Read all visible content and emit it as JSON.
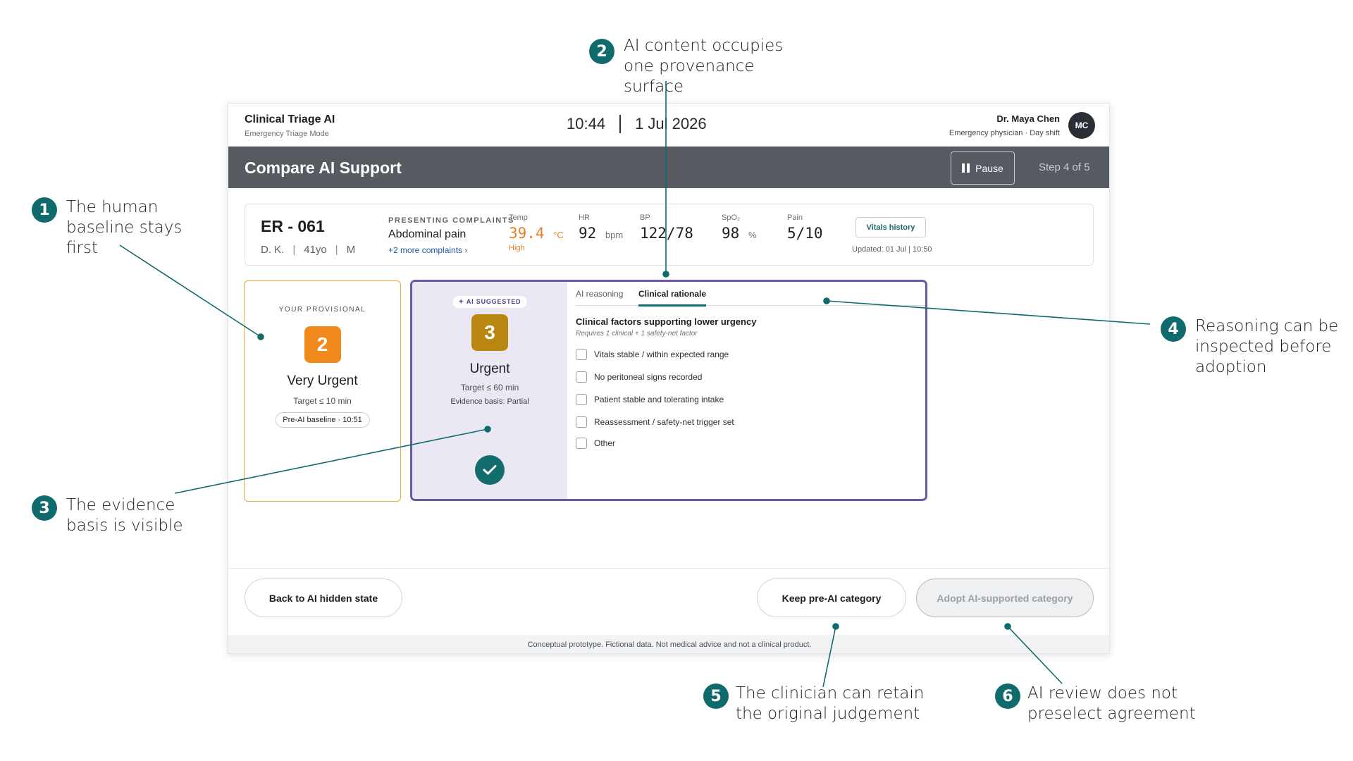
{
  "app": {
    "title": "Clinical Triage AI",
    "mode": "Emergency Triage Mode",
    "time": "10:44",
    "date": "1 Jul 2026",
    "user_name": "Dr. Maya Chen",
    "user_role": "Emergency physician · Day shift",
    "avatar_initials": "MC"
  },
  "titlebar": {
    "title": "Compare AI Support",
    "pause_label": "Pause",
    "step": "Step 4 of 5"
  },
  "patient": {
    "id": "ER - 061",
    "initials": "D. K.",
    "age": "41yo",
    "sex": "M",
    "complaints_label": "PRESENTING COMPLAINTS",
    "complaint": "Abdominal pain",
    "more_complaints": "+2 more complaints  ›",
    "vitals": [
      {
        "label": "Temp",
        "value": "39.4",
        "unit": "°C",
        "flag": "High"
      },
      {
        "label": "HR",
        "value": "92",
        "unit": "bpm",
        "flag": ""
      },
      {
        "label": "BP",
        "value": "122/78",
        "unit": "",
        "flag": ""
      },
      {
        "label": "SpO₂",
        "value": "98",
        "unit": "%",
        "flag": ""
      },
      {
        "label": "Pain",
        "value": "5/10",
        "unit": "",
        "flag": ""
      }
    ],
    "vitals_history_label": "Vitals history",
    "updated": "Updated: 01 Jul | 10:50"
  },
  "provisional": {
    "eyebrow": "YOUR PROVISIONAL",
    "tier": "2",
    "name": "Very Urgent",
    "target": "Target ≤ 10 min",
    "baseline": "Pre-AI baseline · 10:51",
    "color": "#f08a1c"
  },
  "ai": {
    "tag": "AI SUGGESTED",
    "tier": "3",
    "name": "Urgent",
    "target": "Target ≤ 60 min",
    "evidence": "Evidence basis: Partial",
    "color": "#b9860f",
    "tabs": [
      "AI reasoning",
      "Clinical rationale"
    ],
    "active_tab": "Clinical rationale",
    "rationale_title": "Clinical factors supporting lower urgency",
    "rationale_sub": "Requires 1 clinical + 1 safety-net factor",
    "factors": [
      "Vitals stable / within expected range",
      "No peritoneal signs recorded",
      "Patient stable and tolerating intake",
      "Reassessment / safety-net trigger set",
      "Other"
    ]
  },
  "actions": {
    "back": "Back to AI hidden state",
    "keep": "Keep pre-AI category",
    "adopt": "Adopt AI-supported category"
  },
  "disclaimer": "Conceptual prototype. Fictional data. Not medical advice and not a clinical product.",
  "callouts": [
    {
      "num": "1",
      "text": "The human baseline stays first"
    },
    {
      "num": "2",
      "text": "AI content occupies one provenance surface"
    },
    {
      "num": "3",
      "text": "The evidence basis is visible"
    },
    {
      "num": "4",
      "text": "Reasoning can be inspected before adoption"
    },
    {
      "num": "5",
      "text": "The clinician can retain the original judgement"
    },
    {
      "num": "6",
      "text": "AI review does not preselect agreement"
    }
  ],
  "colors": {
    "accent": "#0f6b6c",
    "ai_border": "#6b59a6",
    "ai_fill": "#ebe8f4",
    "header": "#555b61"
  }
}
